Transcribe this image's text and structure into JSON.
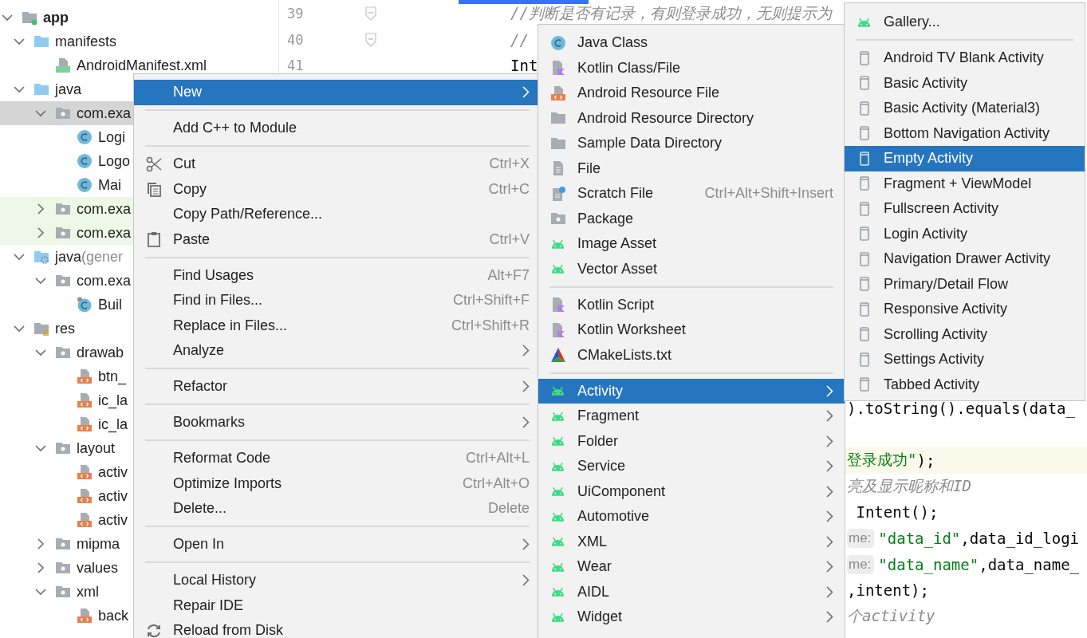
{
  "project_tree": [
    {
      "label": "app",
      "kind": "module",
      "expanded": true,
      "selected": false,
      "tinted": false,
      "children": [
        {
          "label": "manifests",
          "kind": "source-folder",
          "expanded": true,
          "selected": false,
          "tinted": false,
          "children": [
            {
              "label": "AndroidManifest.xml",
              "kind": "manifest",
              "selected": false,
              "tinted": false
            }
          ]
        },
        {
          "label": "java",
          "kind": "source-folder",
          "expanded": true,
          "selected": false,
          "tinted": false,
          "children": [
            {
              "label": "com.exa",
              "kind": "package",
              "expanded": true,
              "selected": true,
              "tinted": false,
              "children": [
                {
                  "label": "Logi",
                  "kind": "class",
                  "selected": false,
                  "tinted": false
                },
                {
                  "label": "Logo",
                  "kind": "class",
                  "selected": false,
                  "tinted": false
                },
                {
                  "label": "Mai",
                  "kind": "class",
                  "selected": false,
                  "tinted": false
                }
              ]
            },
            {
              "label": "com.exa",
              "kind": "package",
              "expanded": false,
              "selected": false,
              "tinted": true
            },
            {
              "label": "com.exa",
              "kind": "package",
              "expanded": false,
              "selected": false,
              "tinted": true
            }
          ]
        },
        {
          "label": "java",
          "note": "(gener",
          "kind": "generated-folder",
          "expanded": true,
          "selected": false,
          "tinted": false,
          "children": [
            {
              "label": "com.exa",
              "kind": "package",
              "expanded": true,
              "selected": false,
              "tinted": false,
              "children": [
                {
                  "label": "Buil",
                  "kind": "generated-class",
                  "selected": false,
                  "tinted": false
                }
              ]
            }
          ]
        },
        {
          "label": "res",
          "kind": "res-folder",
          "expanded": true,
          "selected": false,
          "tinted": false,
          "children": [
            {
              "label": "drawab",
              "kind": "package",
              "expanded": true,
              "selected": false,
              "tinted": false,
              "children": [
                {
                  "label": "btn_",
                  "kind": "resource",
                  "selected": false,
                  "tinted": false
                },
                {
                  "label": "ic_la",
                  "kind": "resource",
                  "selected": false,
                  "tinted": false
                },
                {
                  "label": "ic_la",
                  "kind": "resource",
                  "selected": false,
                  "tinted": false
                }
              ]
            },
            {
              "label": "layout",
              "kind": "package",
              "expanded": true,
              "selected": false,
              "tinted": false,
              "children": [
                {
                  "label": "activ",
                  "kind": "resource",
                  "selected": false,
                  "tinted": false
                },
                {
                  "label": "activ",
                  "kind": "resource",
                  "selected": false,
                  "tinted": false
                },
                {
                  "label": "activ",
                  "kind": "resource",
                  "selected": false,
                  "tinted": false
                }
              ]
            },
            {
              "label": "mipma",
              "kind": "package",
              "expanded": false,
              "selected": false,
              "tinted": false
            },
            {
              "label": "values",
              "kind": "package",
              "expanded": false,
              "selected": false,
              "tinted": false
            },
            {
              "label": "xml",
              "kind": "package",
              "expanded": true,
              "selected": false,
              "tinted": false,
              "children": [
                {
                  "label": "back",
                  "kind": "resource",
                  "selected": false,
                  "tinted": false
                }
              ]
            }
          ]
        }
      ]
    }
  ],
  "editor": {
    "lines": [
      {
        "number": "39",
        "kind": "fold",
        "current": false,
        "segments": [
          {
            "kind": "comment",
            "text": "//判断是否有记录，有则登录成功，无则提示为"
          }
        ]
      },
      {
        "number": "40",
        "kind": "fold",
        "current": false,
        "segments": [
          {
            "kind": "comment",
            "text": "//"
          }
        ]
      },
      {
        "number": "41",
        "kind": "plain",
        "current": false,
        "segments": [
          {
            "kind": "code",
            "text": "Int"
          }
        ]
      }
    ],
    "tail_lines": [
      {
        "current": false,
        "segments": [
          {
            "kind": "code",
            "text": ").toString().equals(data_"
          }
        ]
      },
      {
        "current": false
      },
      {
        "current": true,
        "segments": [
          {
            "kind": "string",
            "text": "登录成功\""
          },
          {
            "kind": "code",
            "text": ");"
          }
        ]
      },
      {
        "current": false,
        "segments": [
          {
            "kind": "comment",
            "text": "亮及显示昵称和ID"
          }
        ]
      },
      {
        "current": false,
        "segments": [
          {
            "kind": "code",
            "text": " Intent();"
          }
        ]
      },
      {
        "current": false,
        "segments": [
          {
            "kind": "hint",
            "text": "me:"
          },
          {
            "kind": "string",
            "text": "\"data_id\""
          },
          {
            "kind": "code",
            "text": ",data_id_logi"
          }
        ]
      },
      {
        "current": false,
        "segments": [
          {
            "kind": "hint",
            "text": "me:"
          },
          {
            "kind": "string",
            "text": "\"data_name\""
          },
          {
            "kind": "code",
            "text": ",data_name_"
          }
        ]
      },
      {
        "current": false,
        "segments": [
          {
            "kind": "code",
            "text": ",intent);"
          }
        ]
      },
      {
        "current": false,
        "segments": [
          {
            "kind": "comment",
            "text": "个activity"
          }
        ]
      }
    ]
  },
  "context_menu": {
    "items": [
      {
        "kind": "plain",
        "label": "New",
        "selected": true,
        "submenu": true
      },
      {
        "kind": "separator"
      },
      {
        "kind": "plain",
        "label": "Add C++ to Module",
        "selected": false,
        "submenu": false
      },
      {
        "kind": "separator"
      },
      {
        "kind": "scissors",
        "label": "Cut",
        "shortcut": "Ctrl+X",
        "selected": false,
        "submenu": false
      },
      {
        "kind": "copy",
        "label": "Copy",
        "shortcut": "Ctrl+C",
        "selected": false,
        "submenu": false
      },
      {
        "kind": "plain",
        "label": "Copy Path/Reference...",
        "selected": false,
        "submenu": false
      },
      {
        "kind": "paste",
        "label": "Paste",
        "shortcut": "Ctrl+V",
        "selected": false,
        "submenu": false
      },
      {
        "kind": "separator"
      },
      {
        "kind": "plain",
        "label": "Find Usages",
        "shortcut": "Alt+F7",
        "selected": false,
        "submenu": false
      },
      {
        "kind": "plain",
        "label": "Find in Files...",
        "shortcut": "Ctrl+Shift+F",
        "selected": false,
        "submenu": false
      },
      {
        "kind": "plain",
        "label": "Replace in Files...",
        "shortcut": "Ctrl+Shift+R",
        "selected": false,
        "submenu": false
      },
      {
        "kind": "plain",
        "label": "Analyze",
        "selected": false,
        "submenu": true
      },
      {
        "kind": "separator"
      },
      {
        "kind": "plain",
        "label": "Refactor",
        "selected": false,
        "submenu": true
      },
      {
        "kind": "separator"
      },
      {
        "kind": "plain",
        "label": "Bookmarks",
        "selected": false,
        "submenu": true
      },
      {
        "kind": "separator"
      },
      {
        "kind": "plain",
        "label": "Reformat Code",
        "shortcut": "Ctrl+Alt+L",
        "selected": false,
        "submenu": false
      },
      {
        "kind": "plain",
        "label": "Optimize Imports",
        "shortcut": "Ctrl+Alt+O",
        "selected": false,
        "submenu": false
      },
      {
        "kind": "plain",
        "label": "Delete...",
        "shortcut": "Delete",
        "selected": false,
        "submenu": false
      },
      {
        "kind": "separator"
      },
      {
        "kind": "plain",
        "label": "Open In",
        "selected": false,
        "submenu": true
      },
      {
        "kind": "separator"
      },
      {
        "kind": "plain",
        "label": "Local History",
        "selected": false,
        "submenu": true
      },
      {
        "kind": "plain",
        "label": "Repair IDE",
        "selected": false,
        "submenu": false
      },
      {
        "kind": "reload",
        "label": "Reload from Disk",
        "selected": false,
        "submenu": false
      }
    ]
  },
  "new_submenu": {
    "items": [
      {
        "kind": "class",
        "label": "Java Class",
        "selected": false,
        "submenu": false
      },
      {
        "kind": "kotlin",
        "label": "Kotlin Class/File",
        "selected": false,
        "submenu": false
      },
      {
        "kind": "resource",
        "label": "Android Resource File",
        "selected": false,
        "submenu": false
      },
      {
        "kind": "folder",
        "label": "Android Resource Directory",
        "selected": false,
        "submenu": false
      },
      {
        "kind": "folder",
        "label": "Sample Data Directory",
        "selected": false,
        "submenu": false
      },
      {
        "kind": "file",
        "label": "File",
        "selected": false,
        "submenu": false
      },
      {
        "kind": "scratch",
        "label": "Scratch File",
        "shortcut": "Ctrl+Alt+Shift+Insert",
        "selected": false,
        "submenu": false
      },
      {
        "kind": "package",
        "label": "Package",
        "selected": false,
        "submenu": false
      },
      {
        "kind": "android",
        "label": "Image Asset",
        "selected": false,
        "submenu": false
      },
      {
        "kind": "android",
        "label": "Vector Asset",
        "selected": false,
        "submenu": false
      },
      {
        "kind": "separator"
      },
      {
        "kind": "kotlin",
        "label": "Kotlin Script",
        "selected": false,
        "submenu": false
      },
      {
        "kind": "kotlin",
        "label": "Kotlin Worksheet",
        "selected": false,
        "submenu": false
      },
      {
        "kind": "cmake",
        "label": "CMakeLists.txt",
        "selected": false,
        "submenu": false
      },
      {
        "kind": "separator"
      },
      {
        "kind": "android",
        "label": "Activity",
        "selected": true,
        "submenu": true
      },
      {
        "kind": "android",
        "label": "Fragment",
        "selected": false,
        "submenu": true
      },
      {
        "kind": "android",
        "label": "Folder",
        "selected": false,
        "submenu": true
      },
      {
        "kind": "android",
        "label": "Service",
        "selected": false,
        "submenu": true
      },
      {
        "kind": "android",
        "label": "UiComponent",
        "selected": false,
        "submenu": true
      },
      {
        "kind": "android",
        "label": "Automotive",
        "selected": false,
        "submenu": true
      },
      {
        "kind": "android",
        "label": "XML",
        "selected": false,
        "submenu": true
      },
      {
        "kind": "android",
        "label": "Wear",
        "selected": false,
        "submenu": true
      },
      {
        "kind": "android",
        "label": "AIDL",
        "selected": false,
        "submenu": true
      },
      {
        "kind": "android",
        "label": "Widget",
        "selected": false,
        "submenu": true
      }
    ]
  },
  "activity_submenu": {
    "items": [
      {
        "kind": "android",
        "label": "Gallery...",
        "selected": false
      },
      {
        "kind": "separator"
      },
      {
        "kind": "screen",
        "label": "Android TV Blank Activity",
        "selected": false
      },
      {
        "kind": "screen",
        "label": "Basic Activity",
        "selected": false
      },
      {
        "kind": "screen",
        "label": "Basic Activity (Material3)",
        "selected": false
      },
      {
        "kind": "screen",
        "label": "Bottom Navigation Activity",
        "selected": false
      },
      {
        "kind": "screen",
        "label": "Empty Activity",
        "selected": true
      },
      {
        "kind": "screen",
        "label": "Fragment + ViewModel",
        "selected": false
      },
      {
        "kind": "screen",
        "label": "Fullscreen Activity",
        "selected": false
      },
      {
        "kind": "screen",
        "label": "Login Activity",
        "selected": false
      },
      {
        "kind": "screen",
        "label": "Navigation Drawer Activity",
        "selected": false
      },
      {
        "kind": "screen",
        "label": "Primary/Detail Flow",
        "selected": false
      },
      {
        "kind": "screen",
        "label": "Responsive Activity",
        "selected": false
      },
      {
        "kind": "screen",
        "label": "Scrolling Activity",
        "selected": false
      },
      {
        "kind": "screen",
        "label": "Settings Activity",
        "selected": false
      },
      {
        "kind": "screen",
        "label": "Tabbed Activity",
        "selected": false
      }
    ]
  }
}
